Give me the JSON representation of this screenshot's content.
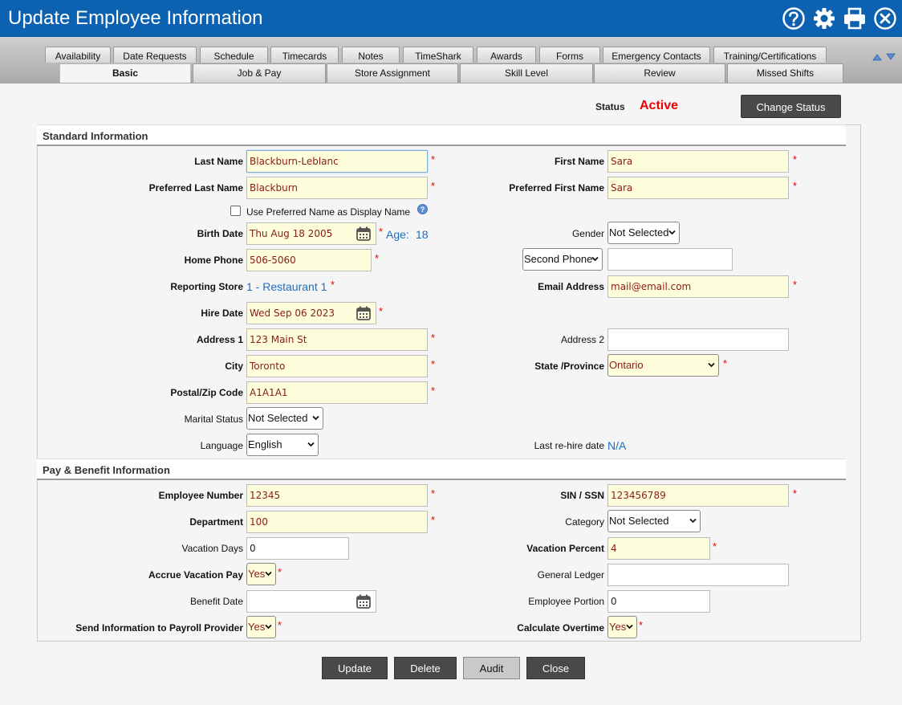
{
  "window": {
    "title": "Update Employee Information"
  },
  "tabs_row1": [
    "Availability",
    "Date Requests",
    "Schedule",
    "Timecards",
    "Notes",
    "TimeShark",
    "Awards",
    "Forms",
    "Emergency Contacts",
    "Training/Certifications"
  ],
  "tabs_row2": [
    "Basic",
    "Job & Pay",
    "Store Assignment",
    "Skill Level",
    "Review",
    "Missed Shifts"
  ],
  "status": {
    "label": "Status",
    "value": "Active",
    "change_button": "Change Status"
  },
  "sections": {
    "standard": "Standard Information",
    "pay": "Pay & Benefit Information"
  },
  "form": {
    "last_name": {
      "label": "Last Name",
      "value": "Blackburn-Leblanc"
    },
    "first_name": {
      "label": "First Name",
      "value": "Sara"
    },
    "pref_last_name": {
      "label": "Preferred Last Name",
      "value": "Blackburn"
    },
    "pref_first_name": {
      "label": "Preferred First Name",
      "value": "Sara"
    },
    "use_pref": {
      "label": "Use Preferred Name as Display Name"
    },
    "birth_date": {
      "label": "Birth Date",
      "value": "Thu Aug 18 2005",
      "age_label": "Age:",
      "age_value": "18"
    },
    "gender": {
      "label": "Gender",
      "value": "Not Selected"
    },
    "home_phone": {
      "label": "Home Phone",
      "value": "506-5060"
    },
    "second_phone": {
      "select": "Second Phone",
      "value": ""
    },
    "reporting_store": {
      "label": "Reporting Store",
      "value": "1 - Restaurant 1"
    },
    "email": {
      "label": "Email Address",
      "value": "mail@email.com"
    },
    "hire_date": {
      "label": "Hire Date",
      "value": "Wed Sep 06 2023"
    },
    "address1": {
      "label": "Address 1",
      "value": "123 Main St"
    },
    "address2": {
      "label": "Address 2",
      "value": ""
    },
    "city": {
      "label": "City",
      "value": "Toronto"
    },
    "state": {
      "label": "State /Province",
      "value": "Ontario"
    },
    "postal": {
      "label": "Postal/Zip Code",
      "value": "A1A1A1"
    },
    "marital": {
      "label": "Marital Status",
      "value": "Not Selected"
    },
    "language": {
      "label": "Language",
      "value": "English"
    },
    "rehire": {
      "label": "Last re-hire date",
      "value": "N/A"
    },
    "employee_number": {
      "label": "Employee Number",
      "value": "12345"
    },
    "sin": {
      "label": "SIN / SSN",
      "value": "123456789"
    },
    "department": {
      "label": "Department",
      "value": "100"
    },
    "category": {
      "label": "Category",
      "value": "Not Selected"
    },
    "vacation_days": {
      "label": "Vacation Days",
      "value": "0"
    },
    "vacation_percent": {
      "label": "Vacation Percent",
      "value": "4"
    },
    "accrue_vacation": {
      "label": "Accrue Vacation Pay",
      "value": "Yes"
    },
    "general_ledger": {
      "label": "General Ledger",
      "value": ""
    },
    "benefit_date": {
      "label": "Benefit Date",
      "value": ""
    },
    "employee_portion": {
      "label": "Employee Portion",
      "value": "0"
    },
    "send_payroll": {
      "label": "Send Information to Payroll Provider",
      "value": "Yes"
    },
    "calc_overtime": {
      "label": "Calculate Overtime",
      "value": "Yes"
    }
  },
  "buttons": {
    "update": "Update",
    "delete": "Delete",
    "audit": "Audit",
    "close": "Close"
  },
  "colors": {
    "title_bar": "#0c62b0",
    "required_bg": "#fefedc",
    "required_star": "#e00000",
    "status_active": "#e00000",
    "link_blue": "#1b6fc2"
  },
  "icons": [
    "help-icon",
    "gear-icon",
    "print-icon",
    "close-icon",
    "calendar-icon",
    "info-icon"
  ]
}
